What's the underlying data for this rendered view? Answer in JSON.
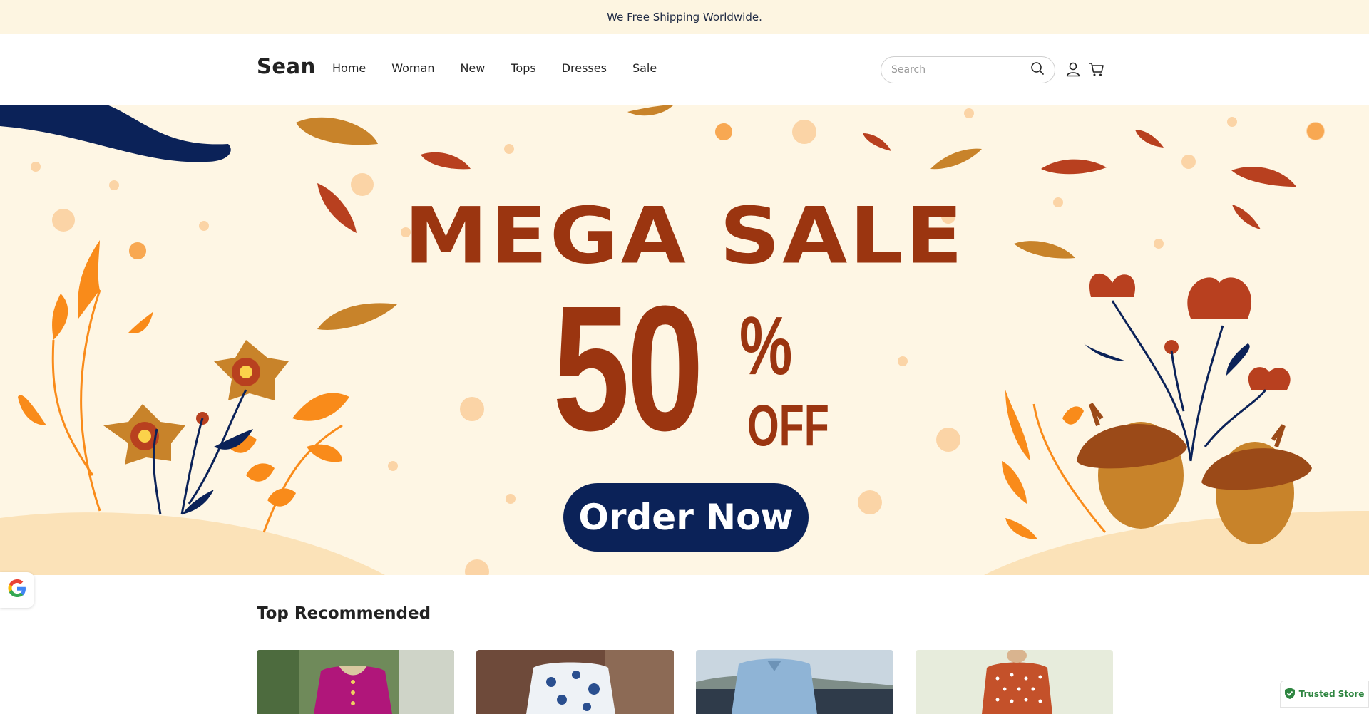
{
  "announcement": "We Free Shipping Worldwide.",
  "header": {
    "logo": "Sean",
    "nav": [
      "Home",
      "Woman",
      "New",
      "Tops",
      "Dresses",
      "Sale"
    ],
    "search_placeholder": "Search",
    "icons": [
      "search-icon",
      "account-icon",
      "cart-icon"
    ]
  },
  "hero": {
    "headline": "MEGA SALE",
    "discount": "50",
    "percent": "%",
    "off": "OFF",
    "cta": "Order Now",
    "colors": {
      "background": "#fef6e4",
      "text": "#9b3510",
      "button": "#0b2258",
      "accent": "#f98b1a"
    }
  },
  "recommended": {
    "title": "Top Recommended",
    "products": [
      {
        "image": "product-image-magenta-top"
      },
      {
        "image": "product-image-floral-dress"
      },
      {
        "image": "product-image-blue-shirt"
      },
      {
        "image": "product-image-polka-dot-top"
      }
    ]
  },
  "badges": {
    "trusted_store": "Trusted Store",
    "google": "google-icon"
  }
}
